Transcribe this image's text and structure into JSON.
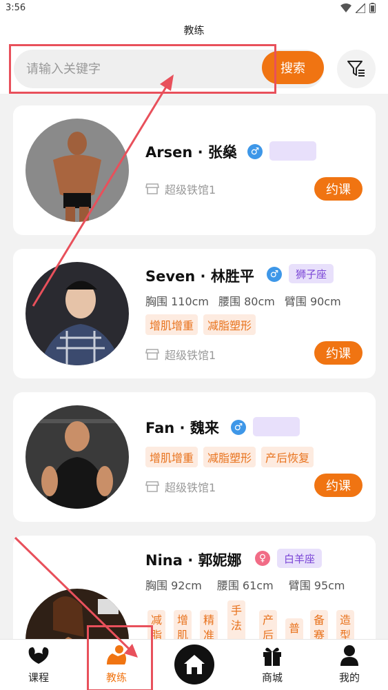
{
  "status": {
    "time": "3:56"
  },
  "header": {
    "title": "教练",
    "search_placeholder": "请输入关键字",
    "search_button": "搜索"
  },
  "coaches": [
    {
      "name": "Arsen · 张燊",
      "gender": "male",
      "sign": "",
      "store": "超级铁馆1",
      "book_label": "约课"
    },
    {
      "name": "Seven · 林胜平",
      "gender": "male",
      "sign": "狮子座",
      "measure": [
        "胸围 110cm",
        "腰围 80cm",
        "臂围 90cm"
      ],
      "tags": [
        "增肌增重",
        "减脂塑形"
      ],
      "store": "超级铁馆1",
      "book_label": "约课"
    },
    {
      "name": "Fan · 魏来",
      "gender": "male",
      "sign": "",
      "tags": [
        "增肌增重",
        "减脂塑形",
        "产后恢复"
      ],
      "store": "超级铁馆1",
      "book_label": "约课"
    },
    {
      "name": "Nina · 郭妮娜",
      "gender": "female",
      "sign": "白羊座",
      "measure": [
        "胸围 92cm",
        "腰围 61cm",
        "臂围 95cm"
      ],
      "vtags": [
        "减脂",
        "增肌",
        "精准",
        "手法",
        "产后",
        "普",
        "备赛",
        "造型"
      ]
    }
  ],
  "gender_symbols": {
    "male": "♂",
    "female": "♀"
  },
  "tabbar": {
    "items": [
      {
        "label": "课程",
        "icon": "muscle-icon"
      },
      {
        "label": "教练",
        "icon": "coach-icon",
        "active": true
      },
      {
        "label": "",
        "icon": "home-icon"
      },
      {
        "label": "商城",
        "icon": "gift-icon"
      },
      {
        "label": "我的",
        "icon": "user-icon"
      }
    ]
  },
  "colors": {
    "accent": "#f07412",
    "annotation": "#e8505b",
    "sign_badge_bg": "#e8e0fb",
    "tag_bg": "#fdebe0"
  }
}
